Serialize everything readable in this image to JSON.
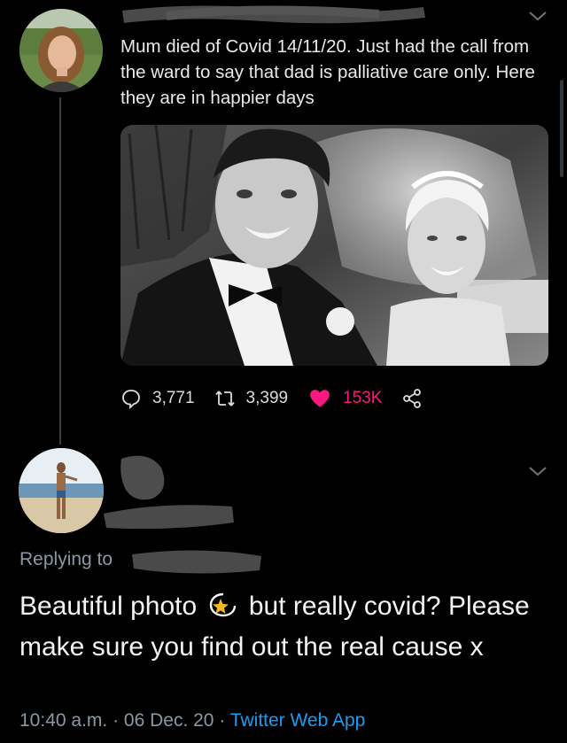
{
  "tweet": {
    "text": "Mum died of Covid 14/11/20. Just had the call from the ward to say that dad is palliative care only. Here they are in happier days",
    "avatar_icon": "profile-avatar-woman-outdoors",
    "photo_description_icon": "wedding-photo-bw",
    "stats": {
      "replies": "3,771",
      "retweets": "3,399",
      "likes": "153K"
    },
    "like_color": "#f91880"
  },
  "reply": {
    "replying_to_label": "Replying to",
    "text_before_emoji": "Beautiful photo ",
    "emoji_icon": "dizzy-star-emoji",
    "text_after_emoji": " but really covid? Please make sure you find out the real cause x",
    "time": "10:40 a.m.",
    "separator": "·",
    "date": "06 Dec. 20",
    "source": "Twitter Web App",
    "source_color": "#1d9bf0"
  }
}
